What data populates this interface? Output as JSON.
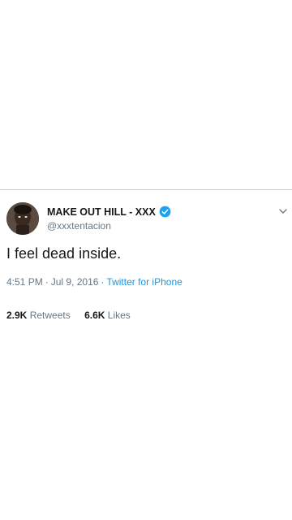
{
  "tweet": {
    "display_name": "MAKE OUT HILL - XXX",
    "handle": "@xxxtentacion",
    "text": "I feel dead inside.",
    "time": "4:51 PM",
    "separator": "·",
    "date": "Jul 9, 2016",
    "source": "Twitter for iPhone",
    "retweets_count": "2.9K",
    "retweets_label": "Retweets",
    "likes_count": "6.6K",
    "likes_label": "Likes"
  },
  "icons": {
    "verified": "verified-badge-icon",
    "menu": "chevron-down-icon"
  },
  "colors": {
    "link": "#1b95e0",
    "verified": "#1da1f2",
    "secondary_text": "#657786",
    "primary_text": "#14171a"
  }
}
